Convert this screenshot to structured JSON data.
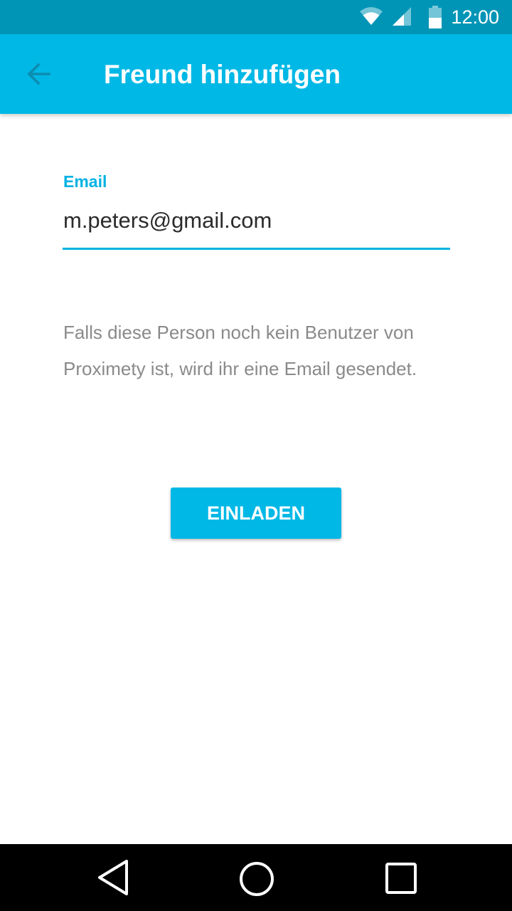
{
  "status_bar": {
    "time": "12:00",
    "icons": [
      "wifi-icon",
      "signal-icon",
      "battery-icon"
    ]
  },
  "app_bar": {
    "title": "Freund hinzufügen",
    "back_icon": "arrow-left-icon"
  },
  "form": {
    "email_label": "Email",
    "email_value": "m.peters@gmail.com"
  },
  "hint": {
    "line1": "Falls diese Person noch kein Benutzer von",
    "line2": "Proximety ist, wird ihr eine Email gesendet."
  },
  "invite_button": {
    "label": "EINLADEN"
  },
  "nav_bar": {
    "icons": [
      "triangle-back-icon",
      "circle-home-icon",
      "square-recents-icon"
    ]
  },
  "colors": {
    "status_bar": "#0095b6",
    "primary": "#00b8e6",
    "accent": "#00b2e3",
    "hint_text": "#8a8a8a",
    "input_text": "#2b2b2b",
    "nav_bar": "#000000"
  }
}
